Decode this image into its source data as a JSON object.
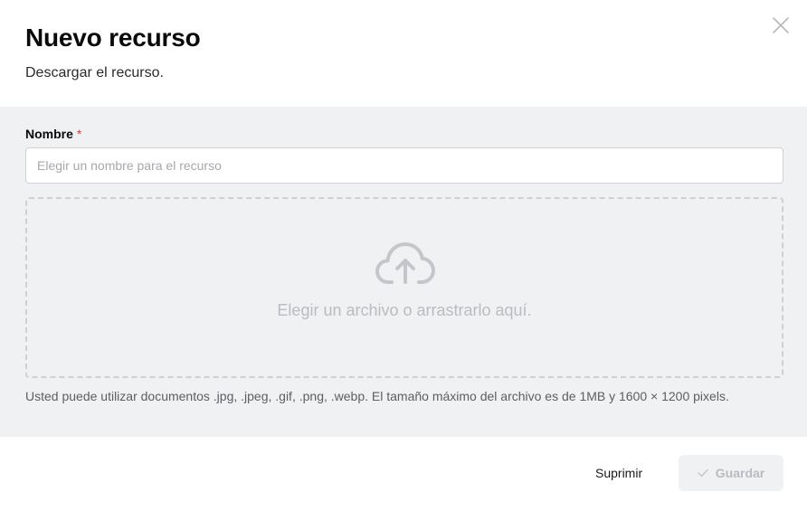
{
  "dialog": {
    "title": "Nuevo recurso",
    "subtitle": "Descargar el recurso.",
    "close_icon": "close-icon"
  },
  "form": {
    "name_label": "Nombre",
    "required_marker": "*",
    "name_placeholder": "Elegir un nombre para el recurso",
    "name_value": "",
    "dropzone_icon": "cloud-upload-icon",
    "dropzone_text": "Elegir un archivo o arrastrarlo aquí.",
    "help_text": "Usted puede utilizar documentos .jpg, .jpeg, .gif, .png, .webp. El tamaño máximo del archivo es de 1MB y 1600 × 1200 pixels."
  },
  "footer": {
    "cancel_label": "Suprimir",
    "save_label": "Guardar",
    "save_icon": "check-icon",
    "save_disabled": true
  },
  "colors": {
    "body_background": "#f0f1f3",
    "required": "#e23b3b",
    "muted_text": "#b9bcc1"
  }
}
